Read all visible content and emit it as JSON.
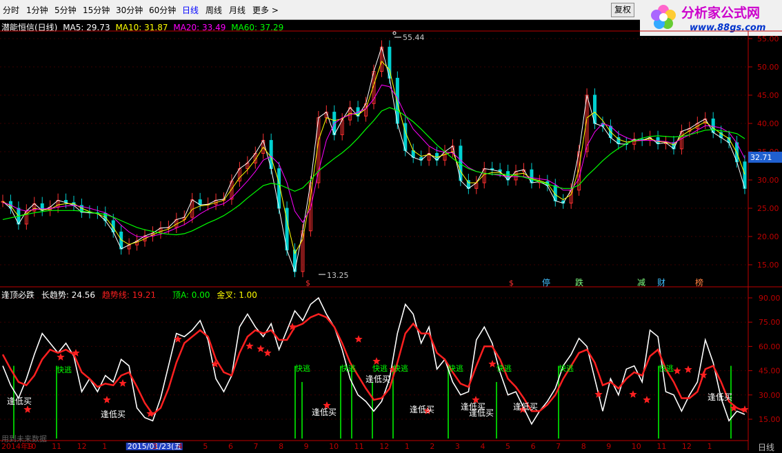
{
  "toolbar": {
    "tabs": [
      "分时",
      "1分钟",
      "5分钟",
      "15分钟",
      "30分钟",
      "60分钟",
      "日线",
      "周线",
      "月线",
      "更多 >"
    ],
    "active_tab": "日线",
    "restore_button": "复权"
  },
  "logo": {
    "title": "分析家公式网",
    "url_text": "www.88gs.com"
  },
  "main_panel": {
    "stock_label": "潜能恒信(日线)",
    "ma": [
      {
        "label": "MA5: 29.73",
        "color": "#ffffff"
      },
      {
        "label": "MA10: 31.87",
        "color": "#ffff00"
      },
      {
        "label": "MA20: 33.49",
        "color": "#ff00ff"
      },
      {
        "label": "MA60: 37.29",
        "color": "#00ff00"
      }
    ],
    "high_label": "55.44",
    "low_label": "13.25",
    "current_price": "32.71",
    "y_ticks": [
      "55.00",
      "50.00",
      "45.00",
      "40.00",
      "35.00",
      "30.00",
      "25.00",
      "20.00",
      "15.00"
    ],
    "markers": [
      {
        "text": "$",
        "color": "#ff3030"
      },
      {
        "text": "$",
        "color": "#ff3030"
      },
      {
        "text": "停",
        "color": "#40c0ff"
      },
      {
        "text": "跌",
        "color": "#80ff80"
      },
      {
        "text": "减",
        "color": "#80ff80"
      },
      {
        "text": "财",
        "color": "#40c0ff"
      },
      {
        "text": "榜",
        "color": "#ff8040"
      }
    ]
  },
  "indicator_panel": {
    "title": "逢顶必跌",
    "items": [
      {
        "label": "长趋势: 24.56",
        "color": "#ffffff"
      },
      {
        "label": "趋势线: 19.21",
        "color": "#ff2020"
      },
      {
        "label": "顶A: 0.00",
        "color": "#00ff00"
      },
      {
        "label": "金叉: 1.00",
        "color": "#ffff00"
      }
    ],
    "y_ticks": [
      "90.00",
      "75.00",
      "60.00",
      "45.00",
      "30.00",
      "15.00"
    ],
    "buy_label": "逢低买",
    "sell_label": "快逃",
    "footer_note": "用到未来数据"
  },
  "chart_data": {
    "type": "line",
    "x_labels": [
      "2014年9",
      "10",
      "11",
      "12",
      "1",
      "2015/01/23(五",
      "3",
      "4",
      "5",
      "6",
      "7",
      "8",
      "9",
      "10",
      "11",
      "12",
      "1",
      "2",
      "3",
      "4",
      "5",
      "6",
      "7",
      "8",
      "9",
      "10",
      "11",
      "12",
      "1"
    ],
    "price_panel": {
      "ylim": [
        12,
        56
      ],
      "series": [
        {
          "name": "MA5",
          "color": "#ffffff",
          "values": [
            26.2,
            25,
            22.2,
            24.5,
            25.8,
            24.6,
            25.2,
            26.4,
            26,
            25.5,
            24.3,
            24.2,
            24.1,
            22.8,
            20.8,
            17.8,
            18.5,
            19.2,
            20.1,
            20.6,
            21.5,
            21.6,
            23,
            23.4,
            26.5,
            25.6,
            25.7,
            26.4,
            26.6,
            29.8,
            32,
            33,
            34.7,
            37,
            32,
            25,
            17.6,
            13.8,
            21,
            29.5,
            41,
            42,
            38,
            40.6,
            42.8,
            41.3,
            43.5,
            49.2,
            53.5,
            48,
            40,
            35.2,
            34,
            33.5,
            34.7,
            33.5,
            35,
            36,
            29.9,
            28.5,
            29.5,
            32,
            31.8,
            31.5,
            30,
            31.5,
            31.8,
            29.5,
            29.7,
            29,
            26.3,
            25.9,
            28.2,
            35,
            45,
            40,
            39.5,
            37.5,
            36.4,
            36.3,
            37.2,
            37,
            37.5,
            36.4,
            36.6,
            35.5,
            38.6,
            39.1,
            40,
            40.8,
            38.4,
            37.5,
            36.6,
            33.2,
            28.5
          ]
        },
        {
          "name": "MA10",
          "color": "#ffff00",
          "values": [
            26.2,
            25.4,
            23.6,
            24,
            25,
            24.7,
            24.8,
            25.6,
            25.8,
            25.8,
            25,
            24.4,
            24,
            23.4,
            21.6,
            19.4,
            18.6,
            19,
            19.6,
            20.3,
            20.9,
            21.3,
            22.2,
            22.9,
            24.8,
            25.4,
            25.6,
            26,
            26.4,
            28.4,
            30.4,
            31.8,
            33.6,
            35.8,
            34,
            29.5,
            22.8,
            17,
            19.5,
            27.2,
            37,
            41,
            40.5,
            40.8,
            41.8,
            41.5,
            42.6,
            46.8,
            51,
            49.5,
            43.5,
            38.5,
            35.2,
            34.2,
            34.5,
            34,
            34.5,
            35,
            31.5,
            29.5,
            29.5,
            31,
            31.3,
            31.3,
            30.5,
            31,
            31.2,
            30.2,
            29.9,
            29.4,
            27.4,
            26.5,
            27.4,
            32,
            41,
            42,
            40.5,
            38.5,
            37.2,
            36.7,
            36.9,
            37,
            37.3,
            36.8,
            36.7,
            36.2,
            37.8,
            38.7,
            39.5,
            40.3,
            39.2,
            38.2,
            37.3,
            34.8,
            31
          ]
        },
        {
          "name": "MA20",
          "color": "#ff00ff",
          "values": [
            26,
            25.6,
            24.8,
            24.5,
            24.8,
            24.9,
            24.9,
            25.2,
            25.4,
            25.5,
            25.3,
            25,
            24.6,
            24.2,
            23.4,
            22,
            20.8,
            20,
            19.9,
            20.1,
            20.4,
            20.9,
            21.5,
            22.1,
            23,
            24,
            24.8,
            25.4,
            25.8,
            26.8,
            28.3,
            29.8,
            31.5,
            33.5,
            34.2,
            32.8,
            29.5,
            24.5,
            22.5,
            25,
            31.5,
            37,
            40,
            41,
            41.5,
            42,
            42.6,
            44.3,
            46.8,
            46.5,
            44.5,
            41.5,
            39,
            37.5,
            36,
            35.2,
            34.9,
            34.8,
            33.5,
            32.2,
            31.5,
            31.2,
            31,
            30.8,
            30.6,
            30.6,
            30.6,
            30.4,
            30.2,
            30,
            29.2,
            28.2,
            28.2,
            30.2,
            36,
            38.5,
            40,
            39.5,
            38.2,
            37.5,
            37,
            37,
            37,
            36.9,
            36.8,
            36.5,
            37.3,
            38,
            38.8,
            39.6,
            39.5,
            39.2,
            38.4,
            36.5,
            33.8
          ]
        },
        {
          "name": "MA60",
          "color": "#00ff00",
          "values": [
            23,
            23.3,
            23.6,
            23.9,
            24.2,
            24.4,
            24.6,
            24.6,
            24.6,
            24.6,
            24.5,
            24.3,
            24.1,
            23.9,
            23.4,
            22.8,
            22.2,
            21.6,
            21.2,
            20.9,
            20.6,
            20.4,
            20.3,
            20.5,
            21,
            21.7,
            22.4,
            23,
            23.7,
            24.6,
            25.6,
            26.8,
            27.9,
            29,
            29.4,
            29.2,
            28.6,
            28,
            28.6,
            30,
            31.6,
            32.7,
            33.8,
            34.8,
            36,
            37.4,
            39,
            40.5,
            42.2,
            42.8,
            42.3,
            41.3,
            40.3,
            39,
            37.6,
            36.2,
            35,
            33.8,
            32.8,
            32,
            31.5,
            31.2,
            31,
            31,
            31,
            30.8,
            30.5,
            30.1,
            29.7,
            29.3,
            28.8,
            28.5,
            28.5,
            29.1,
            30.7,
            32,
            33.4,
            34.6,
            35.6,
            36.4,
            37,
            37.4,
            37.7,
            37.8,
            37.7,
            37.6,
            37.7,
            38,
            38.4,
            38.8,
            38.9,
            38.7,
            38.5,
            38.2,
            37.3
          ]
        }
      ]
    },
    "indicator": {
      "ylim": [
        8,
        98
      ],
      "series": [
        {
          "name": "长趋势",
          "color": "#ffffff",
          "values": [
            48,
            36,
            28,
            40,
            55,
            68,
            62,
            56,
            62,
            54,
            32,
            40,
            32,
            42,
            38,
            52,
            48,
            22,
            16,
            14,
            28,
            48,
            68,
            66,
            70,
            76,
            64,
            40,
            32,
            42,
            72,
            80,
            72,
            66,
            74,
            58,
            70,
            82,
            76,
            86,
            90,
            80,
            72,
            58,
            40,
            30,
            26,
            20,
            26,
            40,
            68,
            86,
            80,
            62,
            72,
            46,
            52,
            38,
            30,
            32,
            64,
            72,
            62,
            44,
            30,
            32,
            22,
            12,
            20,
            26,
            34,
            48,
            55,
            65,
            60,
            40,
            20,
            40,
            30,
            46,
            48,
            38,
            70,
            66,
            32,
            30,
            20,
            30,
            38,
            64,
            50,
            28,
            14,
            20,
            18
          ]
        },
        {
          "name": "趋势线",
          "color": "#ff2020",
          "values": [
            55,
            46,
            38,
            36,
            42,
            52,
            58,
            56,
            58,
            55,
            44,
            40,
            35,
            37,
            36,
            42,
            44,
            35,
            25,
            18,
            22,
            34,
            50,
            62,
            66,
            70,
            66,
            52,
            44,
            42,
            56,
            66,
            70,
            68,
            70,
            64,
            64,
            72,
            74,
            78,
            80,
            78,
            72,
            62,
            50,
            42,
            34,
            27,
            28,
            34,
            50,
            68,
            74,
            68,
            68,
            56,
            52,
            44,
            37,
            35,
            48,
            60,
            60,
            52,
            40,
            35,
            28,
            20,
            20,
            24,
            30,
            40,
            48,
            56,
            58,
            50,
            36,
            38,
            34,
            40,
            44,
            42,
            54,
            58,
            46,
            38,
            28,
            28,
            32,
            46,
            48,
            38,
            26,
            22,
            20
          ]
        }
      ]
    }
  }
}
